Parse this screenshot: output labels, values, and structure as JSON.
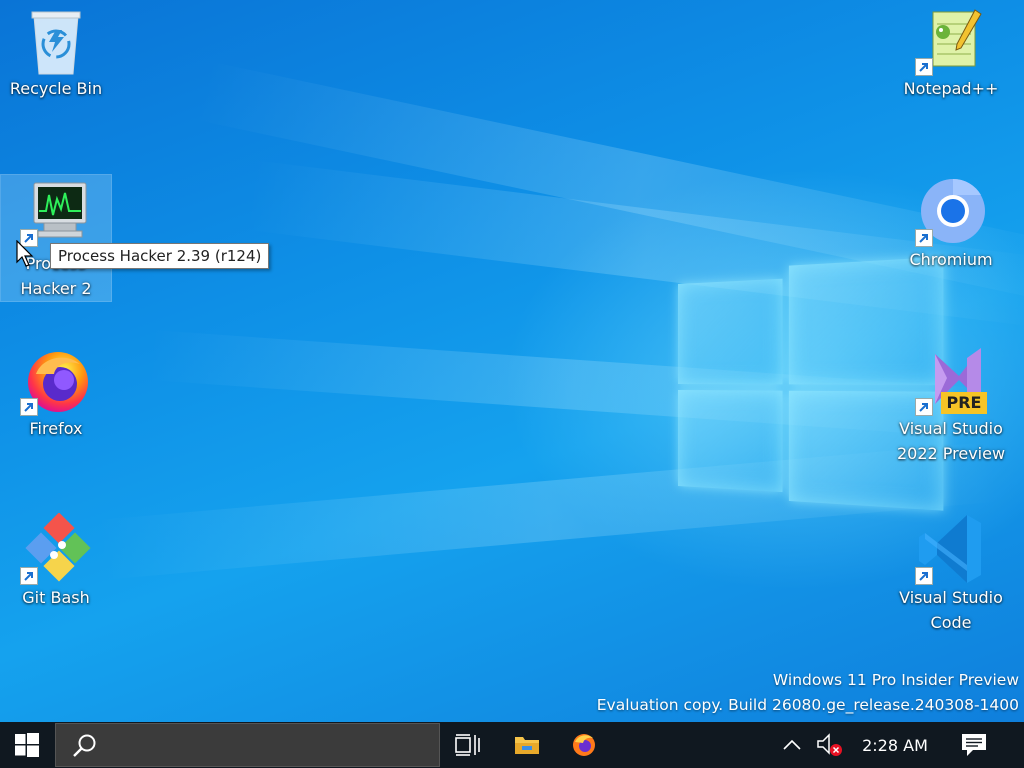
{
  "desktop": {
    "icons": [
      {
        "id": "recycle-bin",
        "label": "Recycle Bin"
      },
      {
        "id": "process-hacker",
        "label": "Process Hacker 2"
      },
      {
        "id": "firefox",
        "label": "Firefox"
      },
      {
        "id": "git-bash",
        "label": "Git Bash"
      },
      {
        "id": "notepadpp",
        "label": "Notepad++"
      },
      {
        "id": "chromium",
        "label": "Chromium"
      },
      {
        "id": "vs-preview",
        "label": "Visual Studio 2022 Preview",
        "badge": "PRE"
      },
      {
        "id": "vscode",
        "label": "Visual Studio Code"
      }
    ],
    "tooltip": "Process Hacker 2.39 (r124)",
    "watermark": {
      "line1": "Windows 11 Pro Insider Preview",
      "line2": "Evaluation copy. Build 26080.ge_release.240308-1400"
    }
  },
  "taskbar": {
    "start": "windows-logo-icon",
    "search_icon": "search-icon",
    "pinned": [
      "task-view-icon",
      "file-explorer-icon",
      "firefox-icon"
    ],
    "tray": [
      "chevron-up-icon",
      "volume-muted-icon"
    ],
    "time": "2:28 AM",
    "notifications": "action-center-icon"
  },
  "colors": {
    "accent": "#0f8be6",
    "taskbar": "#101820"
  }
}
